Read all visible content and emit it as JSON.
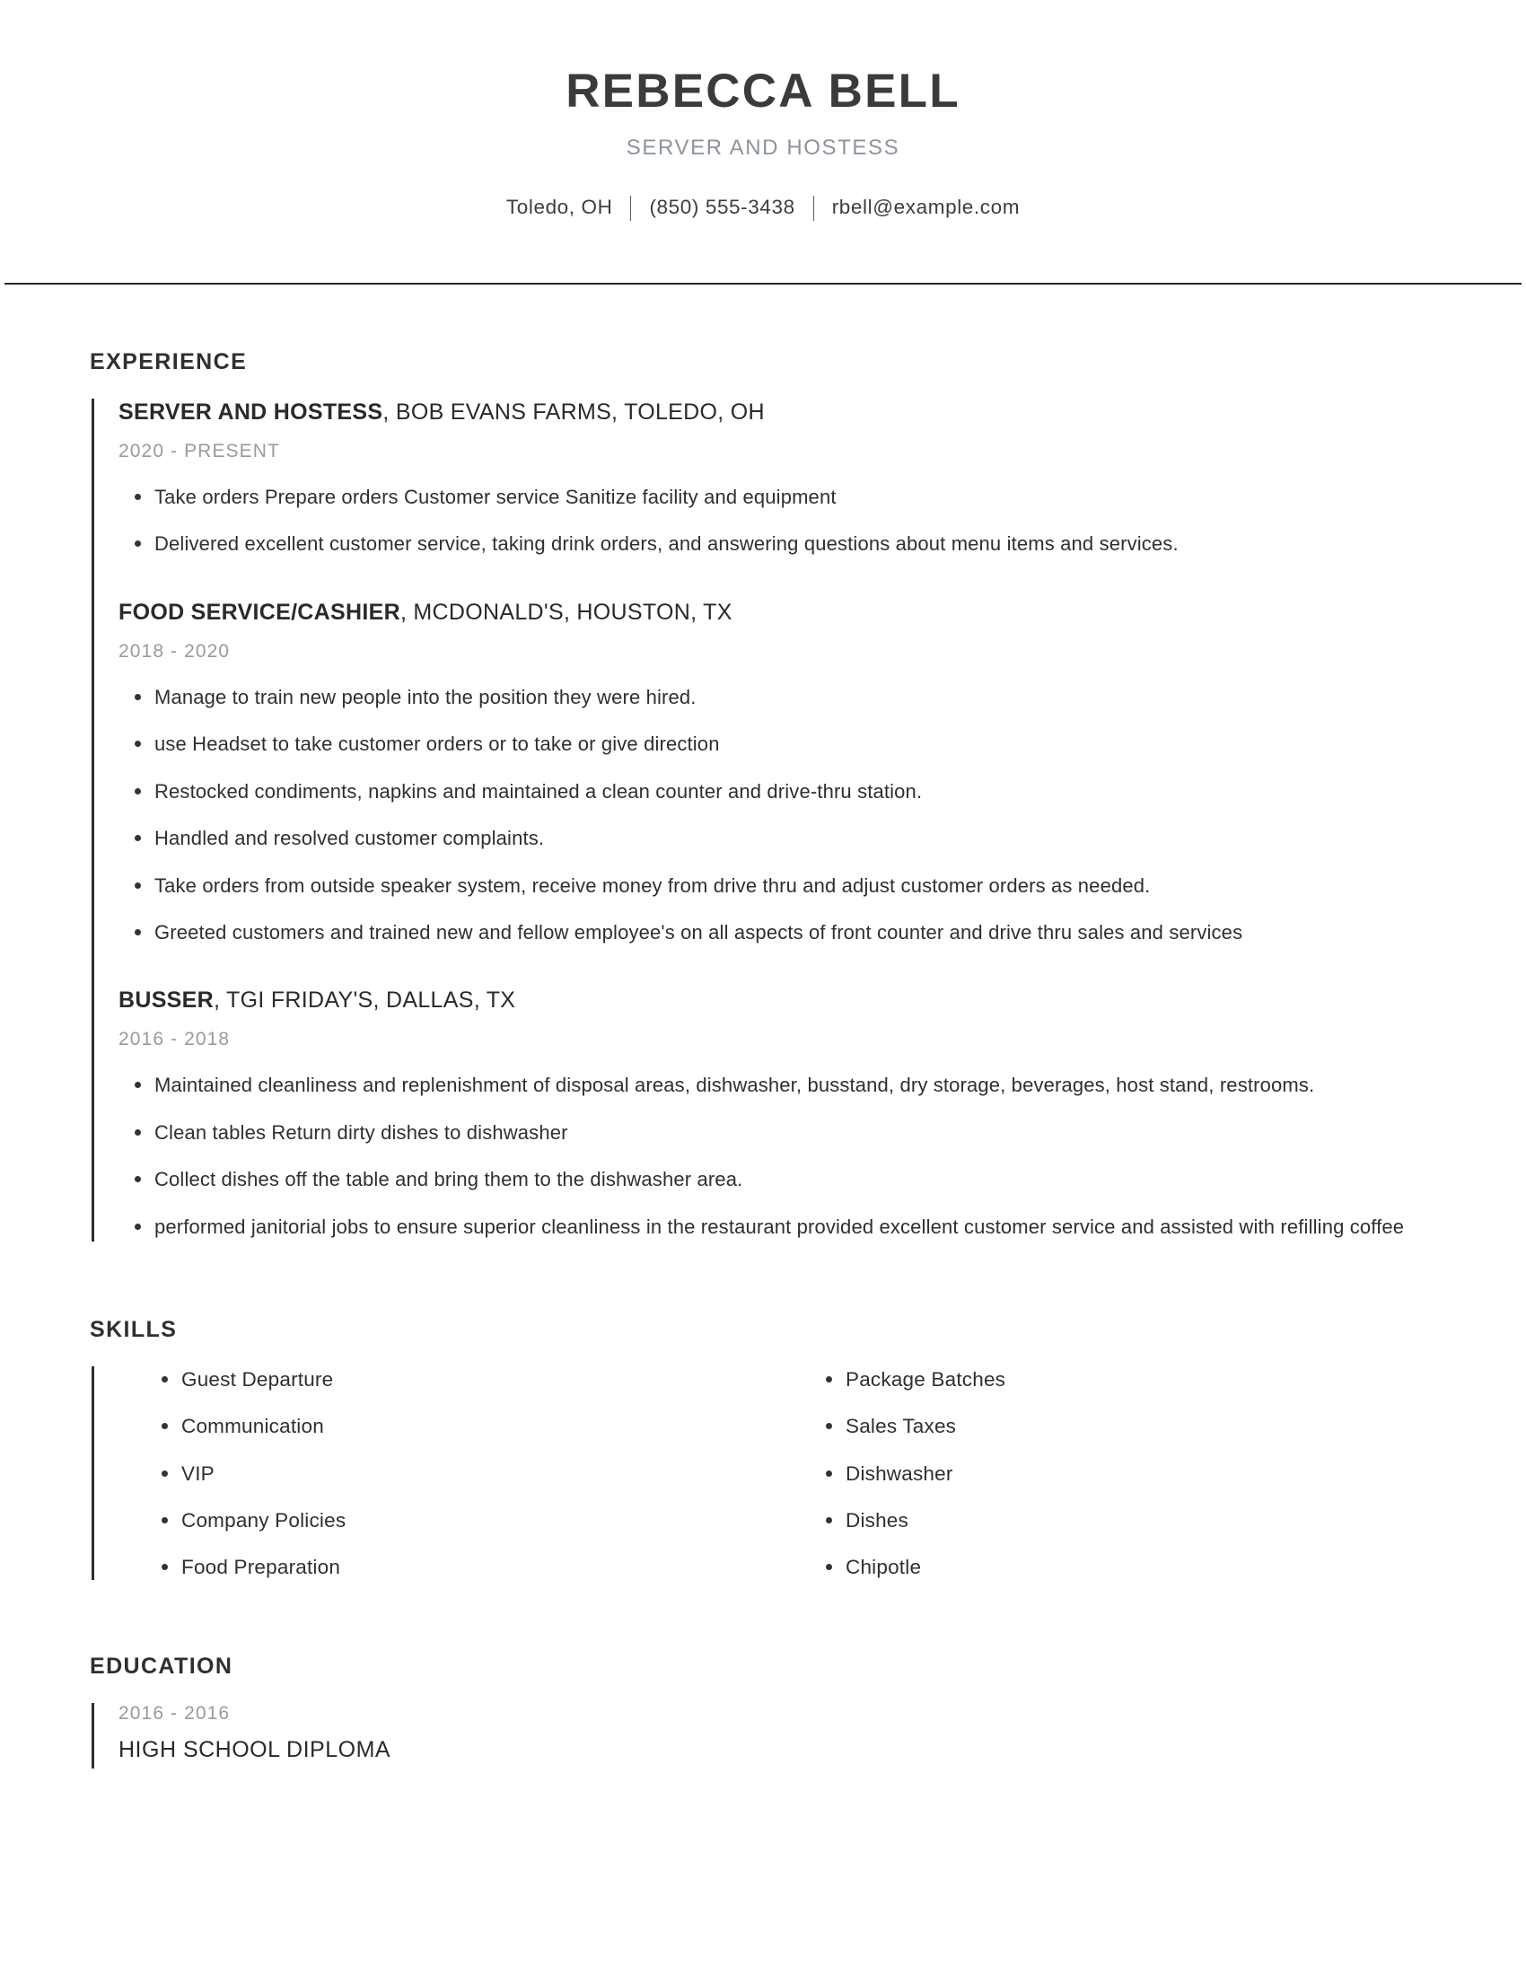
{
  "header": {
    "full_name": "REBECCA BELL",
    "job_title": "SERVER AND HOSTESS",
    "contact": {
      "location": "Toledo, OH",
      "phone": "(850) 555-3438",
      "email": "rbell@example.com"
    }
  },
  "colors": {
    "name_text": "#3b3b3b",
    "subtitle_text": "#8b949d",
    "body_text": "#2f2f2f",
    "date_text": "#9a9a9a",
    "accent_bar": "#2e2e2e",
    "divider": "#262626",
    "background": "#ffffff"
  },
  "sections": {
    "experience_title": "EXPERIENCE",
    "skills_title": "SKILLS",
    "education_title": "EDUCATION"
  },
  "experience": [
    {
      "role": "SERVER AND HOSTESS",
      "company": ", BOB EVANS FARMS, TOLEDO, OH",
      "dates": "2020 - PRESENT",
      "bullets": [
        "Take orders Prepare orders Customer service Sanitize facility and equipment",
        "Delivered excellent customer service, taking drink orders, and answering questions about menu items and services."
      ]
    },
    {
      "role": "FOOD SERVICE/CASHIER",
      "company": ", MCDONALD'S, HOUSTON, TX",
      "dates": "2018 - 2020",
      "bullets": [
        "Manage to train new people into the position they were hired.",
        "use Headset to take customer orders or to take or give direction",
        "Restocked condiments, napkins and maintained a clean counter and drive-thru station.",
        "Handled and resolved customer complaints.",
        "Take orders from outside speaker system, receive money from drive thru and adjust customer orders as needed.",
        "Greeted customers and trained new and fellow employee's on all aspects of front counter and drive thru sales and services"
      ]
    },
    {
      "role": "BUSSER",
      "company": ", TGI FRIDAY'S, DALLAS, TX",
      "dates": "2016 - 2018",
      "bullets": [
        "Maintained cleanliness and replenishment of disposal areas, dishwasher, busstand, dry storage, beverages, host stand, restrooms.",
        "Clean tables Return dirty dishes to dishwasher",
        "Collect dishes off the table and bring them to the dishwasher area.",
        "performed janitorial jobs to ensure superior cleanliness in the restaurant provided excellent customer service and assisted with refilling coffee"
      ]
    }
  ],
  "skills": {
    "left_column": [
      "Guest Departure",
      "Communication",
      "VIP",
      "Company Policies",
      "Food Preparation"
    ],
    "right_column": [
      "Package Batches",
      "Sales Taxes",
      "Dishwasher",
      "Dishes",
      "Chipotle"
    ]
  },
  "education": [
    {
      "dates": "2016 - 2016",
      "degree": "HIGH SCHOOL DIPLOMA"
    }
  ]
}
